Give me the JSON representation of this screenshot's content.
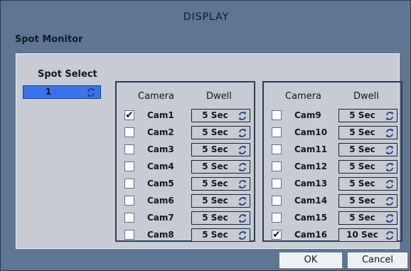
{
  "window": {
    "title": "DISPLAY",
    "section": "Spot Monitor"
  },
  "spot": {
    "heading": "Spot Select",
    "value": "1"
  },
  "columns": {
    "camera": "Camera",
    "dwell": "Dwell"
  },
  "left_group": [
    {
      "camera": "Cam1",
      "checked": true,
      "dwell": "5 Sec"
    },
    {
      "camera": "Cam2",
      "checked": false,
      "dwell": "5 Sec"
    },
    {
      "camera": "Cam3",
      "checked": false,
      "dwell": "5 Sec"
    },
    {
      "camera": "Cam4",
      "checked": false,
      "dwell": "5 Sec"
    },
    {
      "camera": "Cam5",
      "checked": false,
      "dwell": "5 Sec"
    },
    {
      "camera": "Cam6",
      "checked": false,
      "dwell": "5 Sec"
    },
    {
      "camera": "Cam7",
      "checked": false,
      "dwell": "5 Sec"
    },
    {
      "camera": "Cam8",
      "checked": false,
      "dwell": "5 Sec"
    }
  ],
  "right_group": [
    {
      "camera": "Cam9",
      "checked": false,
      "dwell": "5 Sec"
    },
    {
      "camera": "Cam10",
      "checked": false,
      "dwell": "5 Sec"
    },
    {
      "camera": "Cam11",
      "checked": false,
      "dwell": "5 Sec"
    },
    {
      "camera": "Cam12",
      "checked": false,
      "dwell": "5 Sec"
    },
    {
      "camera": "Cam13",
      "checked": false,
      "dwell": "5 Sec"
    },
    {
      "camera": "Cam14",
      "checked": false,
      "dwell": "5 Sec"
    },
    {
      "camera": "Cam15",
      "checked": false,
      "dwell": "5 Sec"
    },
    {
      "camera": "Cam16",
      "checked": true,
      "dwell": "10 Sec"
    }
  ],
  "buttons": {
    "ok": "OK",
    "cancel": "Cancel"
  },
  "icons": {
    "spinner": "refresh-arrows-icon",
    "check": "checkmark-icon"
  },
  "colors": {
    "window_bg": "#5e7691",
    "panel_bg": "#c7ccd4",
    "selected_spinbox": "#3b74e7",
    "check": "#111a35"
  }
}
